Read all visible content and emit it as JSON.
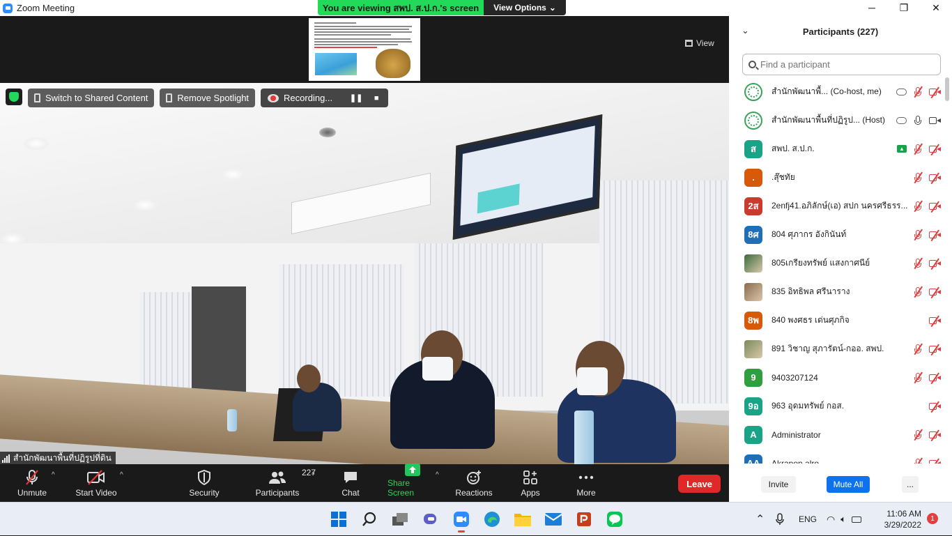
{
  "window": {
    "title": "Zoom Meeting"
  },
  "banner": {
    "viewing": "You are viewing สพป. ส.ป.ก.'s screen",
    "view_options": "View Options"
  },
  "view_button": {
    "label": "View"
  },
  "video_controls": {
    "switch_label": "Switch to Shared Content",
    "spotlight_label": "Remove Spotlight",
    "recording_label": "Recording..."
  },
  "speaker": {
    "name": "สำนักพัฒนาพื้นที่ปฏิรูปที่ดิน"
  },
  "toolbar": {
    "unmute": "Unmute",
    "start_video": "Start Video",
    "security": "Security",
    "participants": "Participants",
    "participants_count": "227",
    "chat": "Chat",
    "share_screen": "Share Screen",
    "reactions": "Reactions",
    "apps": "Apps",
    "more": "More",
    "leave": "Leave"
  },
  "panel": {
    "title": "Participants (227)",
    "search_placeholder": "Find a participant",
    "invite": "Invite",
    "mute_all": "Mute All",
    "more": "..."
  },
  "participants": [
    {
      "name": "สำนักพัฒนาพื้...  (Co-host, me)",
      "avatar": "",
      "avatar_type": "logo",
      "color": "#3aa35a",
      "cloud": true,
      "mic": "muted",
      "cam": "off"
    },
    {
      "name": "สำนักพัฒนาพื้นที่ปฏิรูป...  (Host)",
      "avatar": "",
      "avatar_type": "logo",
      "color": "#3aa35a",
      "cloud": true,
      "mic": "on",
      "cam": "on"
    },
    {
      "name": "สพป. ส.ป.ก.",
      "avatar": "ส",
      "avatar_type": "initial",
      "color": "#1aa386",
      "share": true,
      "mic": "muted",
      "cam": "off"
    },
    {
      "name": ".สุ๊ชทัย",
      "avatar": ".",
      "avatar_type": "initial",
      "color": "#d65a0a",
      "mic": "muted",
      "cam": "off"
    },
    {
      "name": "2enfj41.อภิลักษ์(เอ) สปก นครศรีธรร...",
      "avatar": "2ส",
      "avatar_type": "initial",
      "color": "#c93b2c",
      "mic": "muted",
      "cam": "off"
    },
    {
      "name": "804 ศุภากร อังกินันท์",
      "avatar": "8ศ",
      "avatar_type": "initial",
      "color": "#1f6fb8",
      "mic": "muted",
      "cam": "off"
    },
    {
      "name": "805เกรียงทรัพย์ แสงกาศนีย์",
      "avatar": "",
      "avatar_type": "photo",
      "color": "#3a6b3a",
      "mic": "muted",
      "cam": "off"
    },
    {
      "name": "835 อิทธิพล ศรีนาราง",
      "avatar": "",
      "avatar_type": "photo",
      "color": "#8a6a4a",
      "mic": "muted",
      "cam": "off"
    },
    {
      "name": "840 พงศธร เด่นศุภกิจ",
      "avatar": "8พ",
      "avatar_type": "initial",
      "color": "#d65a0a",
      "mic": "none",
      "cam": "off"
    },
    {
      "name": "891 วิชาญ  สุภารัตน์-กออ. สพป.",
      "avatar": "",
      "avatar_type": "photo",
      "color": "#7a8a5a",
      "mic": "muted",
      "cam": "off"
    },
    {
      "name": "9403207124",
      "avatar": "9",
      "avatar_type": "initial",
      "color": "#2e9e3e",
      "mic": "muted",
      "cam": "off"
    },
    {
      "name": "963 อุดมทรัพย์ กอส.",
      "avatar": "9อ",
      "avatar_type": "initial",
      "color": "#1aa386",
      "mic": "none",
      "cam": "off"
    },
    {
      "name": "Administrator",
      "avatar": "A",
      "avatar_type": "initial",
      "color": "#1aa386",
      "mic": "muted",
      "cam": "off"
    },
    {
      "name": "Akrapon alro",
      "avatar": "AA",
      "avatar_type": "initial",
      "color": "#1f6fb8",
      "mic": "muted",
      "cam": "off"
    }
  ],
  "taskbar": {
    "language": "ENG",
    "time": "11:06 AM",
    "date": "3/29/2022",
    "notifications": "1"
  }
}
